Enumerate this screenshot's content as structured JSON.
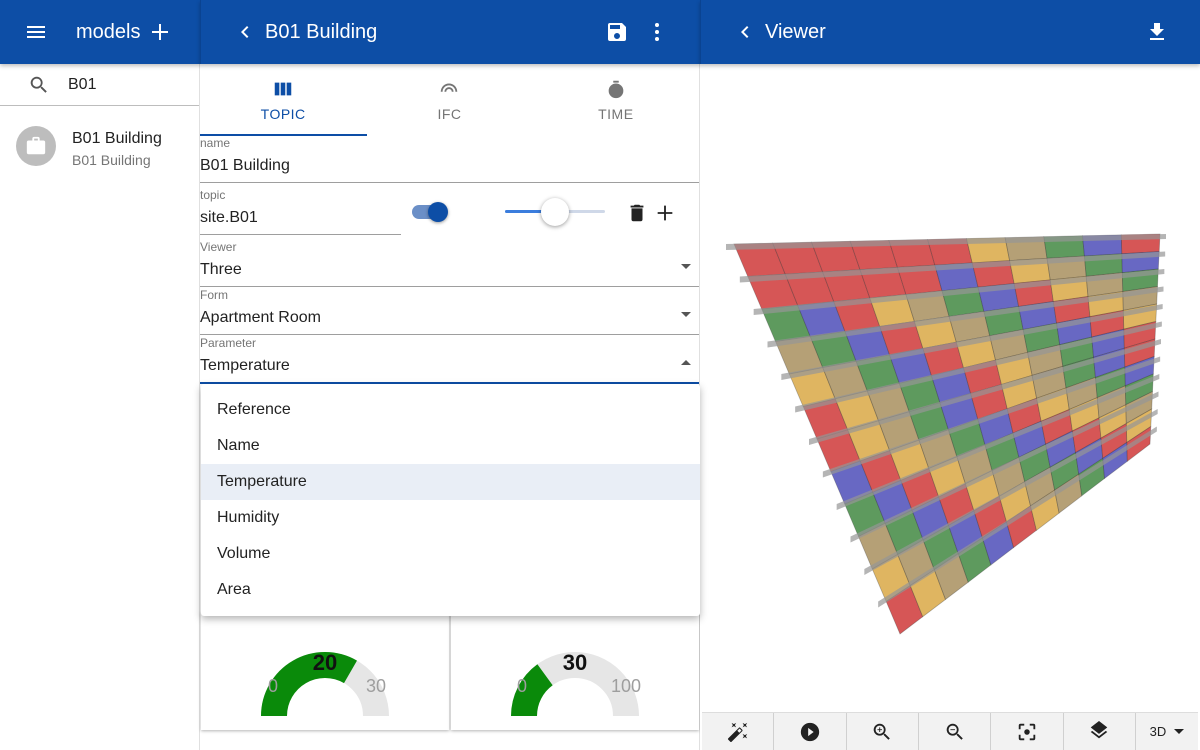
{
  "left": {
    "title": "models",
    "search_value": "B01",
    "items": [
      {
        "title": "B01 Building",
        "subtitle": "B01 Building"
      }
    ]
  },
  "middle": {
    "title": "B01 Building",
    "tabs": [
      {
        "label": "TOPIC",
        "active": true
      },
      {
        "label": "IFC",
        "active": false
      },
      {
        "label": "TIME",
        "active": false
      }
    ],
    "fields": {
      "name": {
        "label": "name",
        "value": "B01 Building"
      },
      "topic": {
        "label": "topic",
        "value": "site.B01"
      },
      "viewer": {
        "label": "Viewer",
        "value": "Three"
      },
      "form": {
        "label": "Form",
        "value": "Apartment Room"
      },
      "parameter": {
        "label": "Parameter",
        "value": "Temperature"
      }
    },
    "toggle_on": true,
    "slider_fraction": 0.5,
    "menu_options": [
      "Reference",
      "Name",
      "Temperature",
      "Humidity",
      "Volume",
      "Area"
    ],
    "menu_selected": "Temperature",
    "gauges": [
      {
        "value": 20,
        "min": 0,
        "max": 30,
        "value_label": "20",
        "min_label": "0",
        "max_label": "30"
      },
      {
        "value": 30,
        "min": 0,
        "max": 100,
        "value_label": "30",
        "min_label": "0",
        "max_label": "100"
      }
    ]
  },
  "right": {
    "title": "Viewer",
    "view_mode": "3D"
  },
  "colors": {
    "appbar": "#0d4ea6",
    "gauge_fill": "#0a8a0a",
    "gauge_track": "#e6e6e6"
  }
}
